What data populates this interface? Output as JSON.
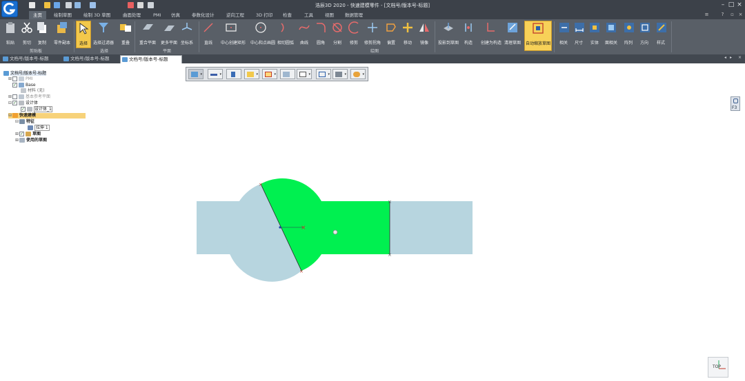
{
  "app": {
    "title": "浩辰3D 2020 - 快速建模零件 - [文档号/版本号-标题]"
  },
  "menu": {
    "tabs": [
      "主页",
      "绘制草图",
      "绘制 3D 草图",
      "曲面处理",
      "PMI",
      "仿真",
      "参数化设计",
      "逆向工程",
      "3D 打印",
      "检查",
      "工具",
      "视图",
      "数据管理"
    ]
  },
  "ribbon": {
    "buttons": [
      {
        "label": "粘贴"
      },
      {
        "label": "剪切"
      },
      {
        "label": "复制"
      },
      {
        "label": "零件副本"
      },
      {
        "label": "选择"
      },
      {
        "label": "选择过滤器"
      },
      {
        "label": "重叠"
      },
      {
        "label": "重合平面"
      },
      {
        "label": "更多平面"
      },
      {
        "label": "坐标系"
      },
      {
        "label": "直线"
      },
      {
        "label": "中心创建矩形"
      },
      {
        "label": "中心和点画圆"
      },
      {
        "label": "相切圆弧"
      },
      {
        "label": "曲线"
      },
      {
        "label": "圆角"
      },
      {
        "label": "分割"
      },
      {
        "label": "修剪"
      },
      {
        "label": "修剪拐角"
      },
      {
        "label": "偏置"
      },
      {
        "label": "移动"
      },
      {
        "label": "镜像"
      },
      {
        "label": "投影到草图"
      },
      {
        "label": "构造"
      },
      {
        "label": "创建为构造"
      },
      {
        "label": "清理草图"
      },
      {
        "label": "自动缩放草图"
      },
      {
        "label": "相关"
      },
      {
        "label": "尺寸"
      },
      {
        "label": "实体"
      },
      {
        "label": "面相关"
      },
      {
        "label": "阵列"
      },
      {
        "label": "方向"
      },
      {
        "label": "样式"
      }
    ],
    "groups": [
      "剪贴板",
      "选择",
      "平面",
      "绘图"
    ]
  },
  "doc_tabs": [
    {
      "label": "文档号/版本号-标题"
    },
    {
      "label": "文档号/版本号-标题"
    },
    {
      "label": "文档号/版本号-标题"
    }
  ],
  "tree": {
    "nodes": [
      {
        "label": "文档号/版本号-标题"
      },
      {
        "label": "PMI"
      },
      {
        "label": "Base"
      },
      {
        "label": "材料 (无)"
      },
      {
        "label": "基本参考平面"
      },
      {
        "label": "设计体"
      },
      {
        "label": "设计体_1"
      },
      {
        "label": "快速建模"
      },
      {
        "label": "特征"
      },
      {
        "label": "拉伸 1"
      },
      {
        "label": "草图"
      },
      {
        "label": "使用的草图"
      }
    ]
  },
  "viewport": {
    "lock_label": "F3",
    "triad_label": "TOP"
  },
  "colors": {
    "accent": "#f3c84b",
    "region_selected": "#00f050",
    "region_unselected": "#b7d5df",
    "titlebar": "#3c4149",
    "ribbon": "#595f67"
  }
}
